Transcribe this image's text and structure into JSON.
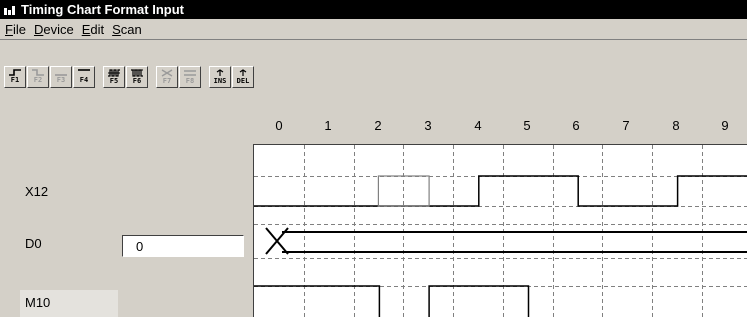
{
  "window": {
    "title": "Timing Chart Format Input"
  },
  "menu": [
    {
      "u": "F",
      "rest": "ile"
    },
    {
      "u": "D",
      "rest": "evice"
    },
    {
      "u": "E",
      "rest": "dit"
    },
    {
      "u": "S",
      "rest": "can"
    }
  ],
  "toolbar": {
    "buttons": [
      {
        "label": "F1",
        "icon": "rise-edge-icon",
        "enabled": true
      },
      {
        "label": "F2",
        "icon": "fall-edge-icon",
        "enabled": false
      },
      {
        "label": "F3",
        "icon": "low-level-icon",
        "enabled": false
      },
      {
        "label": "F4",
        "icon": "high-level-icon",
        "enabled": true
      },
      {
        "label": "F5",
        "icon": "pulse-train-icon",
        "enabled": true
      },
      {
        "label": "F6",
        "icon": "inverted-pulse-icon",
        "enabled": true
      },
      {
        "label": "F7",
        "icon": "cross-icon",
        "enabled": false
      },
      {
        "label": "F8",
        "icon": "level-icon",
        "enabled": false
      },
      {
        "label": "INS",
        "icon": "insert-icon",
        "enabled": true
      },
      {
        "label": "DEL",
        "icon": "delete-icon",
        "enabled": true
      }
    ]
  },
  "columns": [
    "0",
    "1",
    "2",
    "3",
    "4",
    "5",
    "6",
    "7",
    "8",
    "9"
  ],
  "signals": {
    "x12": {
      "name": "X12",
      "levels": [
        0,
        0,
        0,
        0,
        1,
        1,
        0,
        0,
        1,
        1
      ],
      "selected_column": 2
    },
    "d0": {
      "name": "D0",
      "value": "0"
    },
    "m10": {
      "name": "M10",
      "levels": [
        1,
        1,
        0,
        1,
        1,
        0,
        0,
        0,
        0,
        0
      ]
    }
  },
  "colors": {
    "title_bg": "#000000",
    "window_bg": "#d4d0c8",
    "grid": "#808080"
  }
}
